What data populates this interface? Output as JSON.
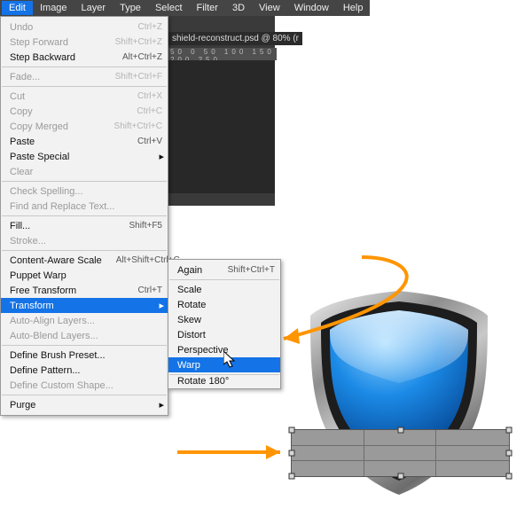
{
  "menubar": [
    "Edit",
    "Image",
    "Layer",
    "Type",
    "Select",
    "Filter",
    "3D",
    "View",
    "Window",
    "Help"
  ],
  "menubar_open_index": 0,
  "doc_tab": "shield-reconstruct.psd @ 80% (r",
  "ruler_text": "50  0  50  100  150  200  250",
  "edit_menu": [
    {
      "label": "Undo",
      "shortcut": "Ctrl+Z",
      "dis": true
    },
    {
      "label": "Step Forward",
      "shortcut": "Shift+Ctrl+Z",
      "dis": true
    },
    {
      "label": "Step Backward",
      "shortcut": "Alt+Ctrl+Z"
    },
    {
      "sep": true
    },
    {
      "label": "Fade...",
      "shortcut": "Shift+Ctrl+F",
      "dis": true
    },
    {
      "sep": true
    },
    {
      "label": "Cut",
      "shortcut": "Ctrl+X",
      "dis": true
    },
    {
      "label": "Copy",
      "shortcut": "Ctrl+C",
      "dis": true
    },
    {
      "label": "Copy Merged",
      "shortcut": "Shift+Ctrl+C",
      "dis": true
    },
    {
      "label": "Paste",
      "shortcut": "Ctrl+V"
    },
    {
      "label": "Paste Special",
      "sub": true
    },
    {
      "label": "Clear",
      "dis": true
    },
    {
      "sep": true
    },
    {
      "label": "Check Spelling...",
      "dis": true
    },
    {
      "label": "Find and Replace Text...",
      "dis": true
    },
    {
      "sep": true
    },
    {
      "label": "Fill...",
      "shortcut": "Shift+F5"
    },
    {
      "label": "Stroke...",
      "dis": true
    },
    {
      "sep": true
    },
    {
      "label": "Content-Aware Scale",
      "shortcut": "Alt+Shift+Ctrl+C"
    },
    {
      "label": "Puppet Warp"
    },
    {
      "label": "Free Transform",
      "shortcut": "Ctrl+T"
    },
    {
      "label": "Transform",
      "sub": true,
      "hi": true
    },
    {
      "label": "Auto-Align Layers...",
      "dis": true
    },
    {
      "label": "Auto-Blend Layers...",
      "dis": true
    },
    {
      "sep": true
    },
    {
      "label": "Define Brush Preset..."
    },
    {
      "label": "Define Pattern..."
    },
    {
      "label": "Define Custom Shape...",
      "dis": true
    },
    {
      "sep": true
    },
    {
      "label": "Purge",
      "sub": true
    }
  ],
  "transform_submenu": [
    {
      "label": "Again",
      "shortcut": "Shift+Ctrl+T"
    },
    {
      "sep": true
    },
    {
      "label": "Scale"
    },
    {
      "label": "Rotate"
    },
    {
      "label": "Skew"
    },
    {
      "label": "Distort"
    },
    {
      "label": "Perspective"
    },
    {
      "label": "Warp",
      "hi": true
    },
    {
      "sep": true
    },
    {
      "label": "Rotate 180°",
      "cut": true
    }
  ]
}
